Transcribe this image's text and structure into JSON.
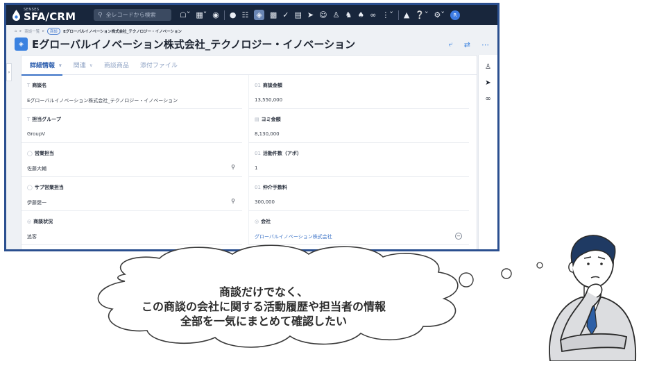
{
  "app": {
    "brand_small": "SENSES",
    "brand_main": "SFA/CRM",
    "search_placeholder": "全レコードから検索",
    "avatar_initial": "R"
  },
  "nav_icons": [
    "home-icon",
    "apps-grid-icon",
    "chat-icon",
    "pin-icon",
    "org-chart-icon",
    "deal-icon",
    "box-icon",
    "check-icon",
    "bank-icon",
    "arrow-icon",
    "face-icon",
    "person-icon",
    "people-icon",
    "team-icon",
    "pair-icon",
    "more-icon",
    "bell-icon",
    "help-icon",
    "settings-icon"
  ],
  "breadcrumb": {
    "home": "⌂",
    "list": "商談一覧",
    "tag": "商談",
    "current": "Eグローバルイノベーション株式会社_テクノロジー・イノベーション"
  },
  "title": "Eグローバルイノベーション株式会社_テクノロジー・イノベーション",
  "tabs": [
    {
      "label": "詳細情報",
      "chevron": true
    },
    {
      "label": "関連",
      "chevron": true
    },
    {
      "label": "商談商品",
      "chevron": false
    },
    {
      "label": "添付ファイル",
      "chevron": false
    }
  ],
  "fields": {
    "left": [
      {
        "label": "商談名",
        "value": "Eグローバルイノベーション株式会社_テクノロジー・イノベーション",
        "action": ""
      },
      {
        "label": "担当グループ",
        "value": "GroupV",
        "action": ""
      },
      {
        "label": "営業担当",
        "value": "佐藤大輔",
        "action": "search"
      },
      {
        "label": "サブ営業担当",
        "value": "伊藤健一",
        "action": "search"
      },
      {
        "label": "商談状況",
        "value": "追客",
        "action": ""
      }
    ],
    "right": [
      {
        "label": "商談金額",
        "value": "13,550,000",
        "action": ""
      },
      {
        "label": "ヨミ金額",
        "value": "8,130,000",
        "action": ""
      },
      {
        "label": "活動件数（アポ）",
        "value": "1",
        "action": ""
      },
      {
        "label": "仲介手数料",
        "value": "300,000",
        "action": ""
      },
      {
        "label": "会社",
        "value": "グローバルイノベーション株式会社",
        "action": "remove"
      }
    ]
  },
  "right_rail_icons": [
    "person-icon",
    "arrow-icon",
    "pair-icon"
  ],
  "thought": {
    "line1": "商談だけでなく、",
    "line2": "この商談の会社に関する活動履歴や担当者の情報",
    "line3": "全部を一気にまとめて確認したい"
  },
  "colors": {
    "frame_border": "#2a4f8f",
    "topbar": "#18263c",
    "accent": "#3b82e0"
  }
}
